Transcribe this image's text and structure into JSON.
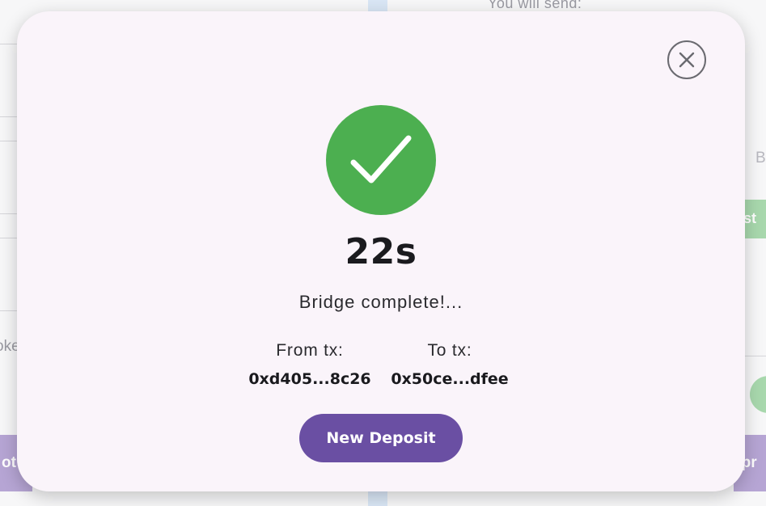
{
  "background": {
    "send_label": "You will send:",
    "left_fragment": "oke",
    "right_fragment_b": "B",
    "green_button_fragment": "st",
    "left_purple_fragment": "ot",
    "right_purple_fragment": "ppr"
  },
  "modal": {
    "close_icon": "close-icon",
    "success_icon": "checkmark-icon",
    "timer": "22s",
    "status": "Bridge complete!...",
    "from_tx": {
      "label": "From tx:",
      "hash": "0xd405...8c26"
    },
    "to_tx": {
      "label": "To tx:",
      "hash": "0x50ce...dfee"
    },
    "new_deposit_label": "New Deposit"
  },
  "colors": {
    "modal_bg": "#faf4fa",
    "success_green": "#4caf50",
    "button_purple": "#6a4fa3",
    "text_dark": "#1a1a1e"
  }
}
